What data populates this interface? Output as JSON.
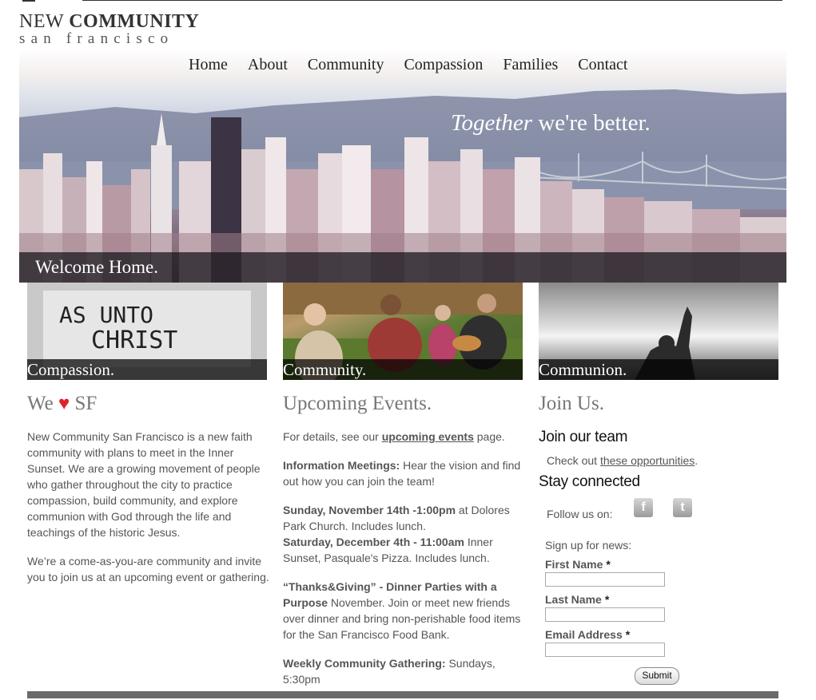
{
  "logo": {
    "line1_regular": "NEW",
    "line1_bold": "COMMUNITY",
    "line2": "san francisco"
  },
  "nav": [
    "Home",
    "About",
    "Community",
    "Compassion",
    "Families",
    "Contact"
  ],
  "hero": {
    "tagline_italic": "Together",
    "tagline_rest": " we're better.",
    "welcome": "Welcome Home."
  },
  "tiles": [
    {
      "caption": "Compassion.",
      "sign_line1": "AS UNTO",
      "sign_line2": "CHRIST"
    },
    {
      "caption": "Community."
    },
    {
      "caption": "Communion."
    }
  ],
  "col1": {
    "heading_we": "We",
    "heart": "♥",
    "heading_sf": "SF",
    "p1": "New Community San Francisco is a new faith community with plans to meet in the Inner Sunset. We are a growing movement of people who gather throughout the city to practice compassion, build community, and explore communion with God through the life and teachings of the historic Jesus.",
    "p2": "We’re a come-as-you-are community and invite you to join us at an upcoming event or gathering."
  },
  "col2": {
    "heading": "Upcoming Events.",
    "details_pre": "For details, see our ",
    "details_link": "upcoming events",
    "details_post": " page.",
    "info_bold": "Information Meetings:",
    "info_text": " Hear the vision and find out how you can join the team!",
    "ev1_bold": "Sunday, November 14th -1:00pm",
    "ev1_text": " at Dolores Park Church. Includes lunch.",
    "ev2_bold": "Saturday, December 4th - 11:00am",
    "ev2_text": " Inner Sunset, Pasquale's Pizza. Includes lunch.",
    "tg_bold": "“Thanks&Giving” - Dinner Parties with a Purpose",
    "tg_text": " November. Join or meet new friends over dinner and bring non-perishable food items for the San Francisco Food Bank.",
    "weekly_bold": "Weekly Community Gathering:",
    "weekly_text": " Sundays, 5:30pm"
  },
  "col3": {
    "heading": "Join Us.",
    "team_heading": "Join our team",
    "team_pre": "Check out ",
    "team_link": "these opportunities",
    "team_post": ".",
    "connected_heading": "Stay connected",
    "follow": "Follow us on:",
    "facebook_icon": "f",
    "twitter_icon": "t",
    "signup": "Sign up for news:",
    "first_name": "First Name",
    "last_name": "Last Name",
    "email": "Email Address",
    "required_mark": "*",
    "submit": "Submit"
  }
}
